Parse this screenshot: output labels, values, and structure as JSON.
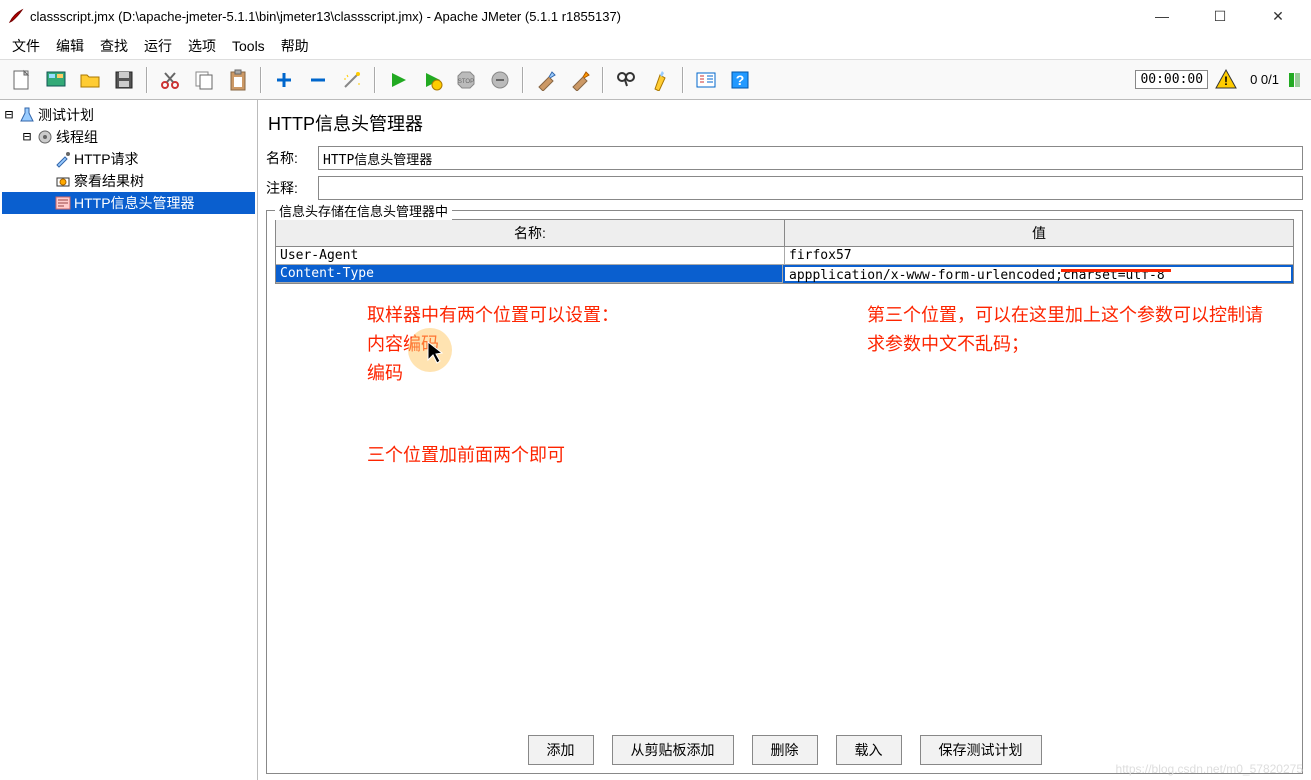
{
  "window": {
    "title": "classscript.jmx (D:\\apache-jmeter-5.1.1\\bin\\jmeter13\\classscript.jmx) - Apache JMeter (5.1.1 r1855137)"
  },
  "menus": [
    "文件",
    "编辑",
    "查找",
    "运行",
    "选项",
    "Tools",
    "帮助"
  ],
  "status": {
    "timer": "00:00:00",
    "counter": "0  0/1"
  },
  "tree": {
    "root": "测试计划",
    "thread_group": "线程组",
    "http_req": "HTTP请求",
    "view_results": "察看结果树",
    "header_mgr": "HTTP信息头管理器"
  },
  "panel": {
    "title": "HTTP信息头管理器",
    "name_label": "名称:",
    "name_value": "HTTP信息头管理器",
    "comment_label": "注释:",
    "comment_value": "",
    "fieldset_legend": "信息头存储在信息头管理器中",
    "table": {
      "headers": [
        "名称:",
        "值"
      ],
      "rows": [
        {
          "name": "User-Agent",
          "value": "firfox57"
        },
        {
          "name": "Content-Type",
          "value": "appplication/x-www-form-urlencoded;charset=utf-8"
        }
      ]
    },
    "buttons": [
      "添加",
      "从剪贴板添加",
      "删除",
      "载入",
      "保存测试计划"
    ]
  },
  "annotations": {
    "left1": "取样器中有两个位置可以设置：",
    "left2": "内容编码",
    "left3": "编码",
    "left4": "三个位置加前面两个即可",
    "right1": "第三个位置，可以在这里加上这个参数可以控制请求参数中文不乱码；"
  },
  "watermark": "https://blog.csdn.net/m0_57820275"
}
